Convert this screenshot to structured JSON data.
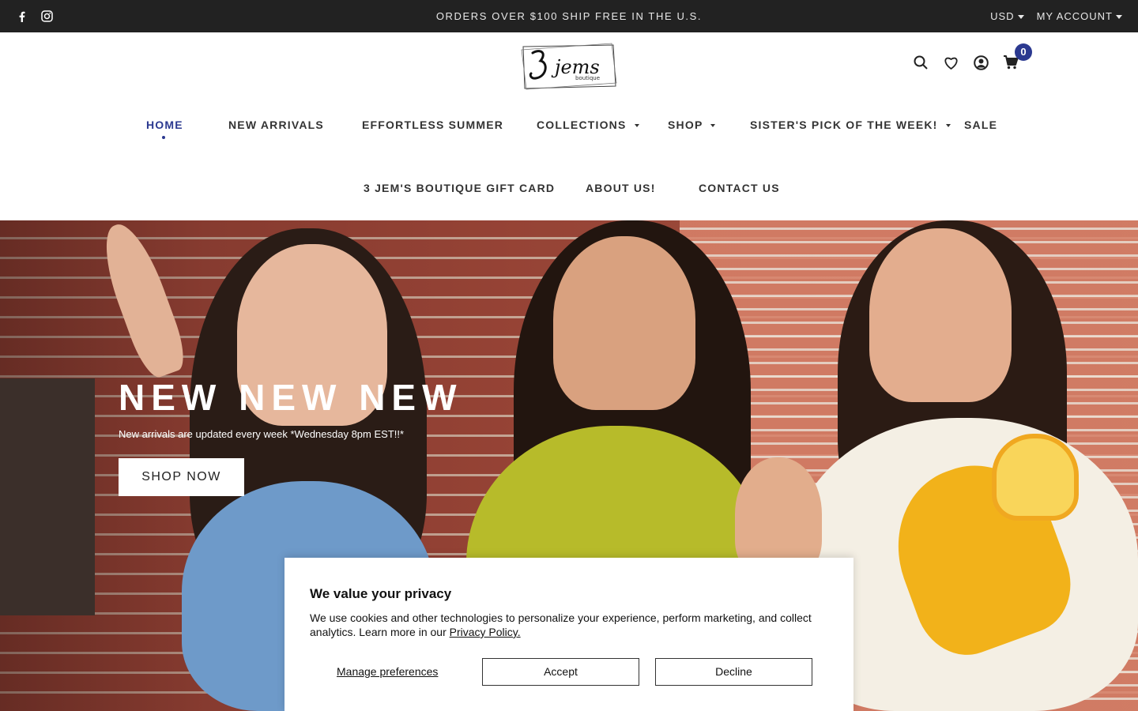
{
  "topbar": {
    "announcement": "ORDERS OVER $100 SHIP FREE IN THE U.S.",
    "currency": "USD",
    "account": "MY ACCOUNT",
    "social": [
      "facebook-icon",
      "instagram-icon"
    ]
  },
  "header": {
    "logo_text": "3 jems",
    "logo_subtext": "boutique",
    "icons": [
      "search-icon",
      "heart-icon",
      "user-icon",
      "cart-icon"
    ],
    "cart_count": "0"
  },
  "nav": {
    "row1": [
      {
        "label": "HOME",
        "active": true
      },
      {
        "label": "NEW ARRIVALS"
      },
      {
        "label": "EFFORTLESS SUMMER"
      },
      {
        "label": "COLLECTIONS",
        "dropdown": true
      },
      {
        "label": "SHOP",
        "dropdown": true
      },
      {
        "label": "SISTER'S PICK OF THE WEEK!",
        "dropdown": true
      },
      {
        "label": "SALE"
      }
    ],
    "row2": [
      {
        "label": "3 JEM'S BOUTIQUE GIFT CARD"
      },
      {
        "label": "ABOUT US!"
      },
      {
        "label": "CONTACT US"
      }
    ]
  },
  "hero": {
    "title": "NEW NEW NEW",
    "subtitle": "New arrivals are updated every week *Wednesday 8pm EST!!*",
    "cta": "SHOP NOW"
  },
  "cookie": {
    "title": "We value your privacy",
    "text": "We use cookies and other technologies to personalize your experience, perform marketing, and collect analytics. Learn more in our ",
    "link": "Privacy Policy.",
    "manage": "Manage preferences",
    "accept": "Accept",
    "decline": "Decline"
  },
  "colors": {
    "accent": "#2b3990",
    "topbar": "#222222"
  }
}
